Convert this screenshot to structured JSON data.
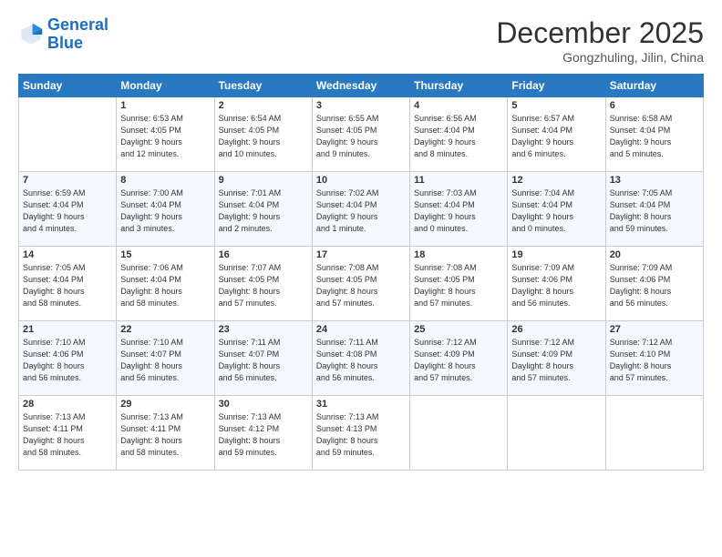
{
  "header": {
    "logo_line1": "General",
    "logo_line2": "Blue",
    "month": "December 2025",
    "location": "Gongzhuling, Jilin, China"
  },
  "weekdays": [
    "Sunday",
    "Monday",
    "Tuesday",
    "Wednesday",
    "Thursday",
    "Friday",
    "Saturday"
  ],
  "weeks": [
    [
      {
        "day": "",
        "info": ""
      },
      {
        "day": "1",
        "info": "Sunrise: 6:53 AM\nSunset: 4:05 PM\nDaylight: 9 hours\nand 12 minutes."
      },
      {
        "day": "2",
        "info": "Sunrise: 6:54 AM\nSunset: 4:05 PM\nDaylight: 9 hours\nand 10 minutes."
      },
      {
        "day": "3",
        "info": "Sunrise: 6:55 AM\nSunset: 4:05 PM\nDaylight: 9 hours\nand 9 minutes."
      },
      {
        "day": "4",
        "info": "Sunrise: 6:56 AM\nSunset: 4:04 PM\nDaylight: 9 hours\nand 8 minutes."
      },
      {
        "day": "5",
        "info": "Sunrise: 6:57 AM\nSunset: 4:04 PM\nDaylight: 9 hours\nand 6 minutes."
      },
      {
        "day": "6",
        "info": "Sunrise: 6:58 AM\nSunset: 4:04 PM\nDaylight: 9 hours\nand 5 minutes."
      }
    ],
    [
      {
        "day": "7",
        "info": "Sunrise: 6:59 AM\nSunset: 4:04 PM\nDaylight: 9 hours\nand 4 minutes."
      },
      {
        "day": "8",
        "info": "Sunrise: 7:00 AM\nSunset: 4:04 PM\nDaylight: 9 hours\nand 3 minutes."
      },
      {
        "day": "9",
        "info": "Sunrise: 7:01 AM\nSunset: 4:04 PM\nDaylight: 9 hours\nand 2 minutes."
      },
      {
        "day": "10",
        "info": "Sunrise: 7:02 AM\nSunset: 4:04 PM\nDaylight: 9 hours\nand 1 minute."
      },
      {
        "day": "11",
        "info": "Sunrise: 7:03 AM\nSunset: 4:04 PM\nDaylight: 9 hours\nand 0 minutes."
      },
      {
        "day": "12",
        "info": "Sunrise: 7:04 AM\nSunset: 4:04 PM\nDaylight: 9 hours\nand 0 minutes."
      },
      {
        "day": "13",
        "info": "Sunrise: 7:05 AM\nSunset: 4:04 PM\nDaylight: 8 hours\nand 59 minutes."
      }
    ],
    [
      {
        "day": "14",
        "info": "Sunrise: 7:05 AM\nSunset: 4:04 PM\nDaylight: 8 hours\nand 58 minutes."
      },
      {
        "day": "15",
        "info": "Sunrise: 7:06 AM\nSunset: 4:04 PM\nDaylight: 8 hours\nand 58 minutes."
      },
      {
        "day": "16",
        "info": "Sunrise: 7:07 AM\nSunset: 4:05 PM\nDaylight: 8 hours\nand 57 minutes."
      },
      {
        "day": "17",
        "info": "Sunrise: 7:08 AM\nSunset: 4:05 PM\nDaylight: 8 hours\nand 57 minutes."
      },
      {
        "day": "18",
        "info": "Sunrise: 7:08 AM\nSunset: 4:05 PM\nDaylight: 8 hours\nand 57 minutes."
      },
      {
        "day": "19",
        "info": "Sunrise: 7:09 AM\nSunset: 4:06 PM\nDaylight: 8 hours\nand 56 minutes."
      },
      {
        "day": "20",
        "info": "Sunrise: 7:09 AM\nSunset: 4:06 PM\nDaylight: 8 hours\nand 56 minutes."
      }
    ],
    [
      {
        "day": "21",
        "info": "Sunrise: 7:10 AM\nSunset: 4:06 PM\nDaylight: 8 hours\nand 56 minutes."
      },
      {
        "day": "22",
        "info": "Sunrise: 7:10 AM\nSunset: 4:07 PM\nDaylight: 8 hours\nand 56 minutes."
      },
      {
        "day": "23",
        "info": "Sunrise: 7:11 AM\nSunset: 4:07 PM\nDaylight: 8 hours\nand 56 minutes."
      },
      {
        "day": "24",
        "info": "Sunrise: 7:11 AM\nSunset: 4:08 PM\nDaylight: 8 hours\nand 56 minutes."
      },
      {
        "day": "25",
        "info": "Sunrise: 7:12 AM\nSunset: 4:09 PM\nDaylight: 8 hours\nand 57 minutes."
      },
      {
        "day": "26",
        "info": "Sunrise: 7:12 AM\nSunset: 4:09 PM\nDaylight: 8 hours\nand 57 minutes."
      },
      {
        "day": "27",
        "info": "Sunrise: 7:12 AM\nSunset: 4:10 PM\nDaylight: 8 hours\nand 57 minutes."
      }
    ],
    [
      {
        "day": "28",
        "info": "Sunrise: 7:13 AM\nSunset: 4:11 PM\nDaylight: 8 hours\nand 58 minutes."
      },
      {
        "day": "29",
        "info": "Sunrise: 7:13 AM\nSunset: 4:11 PM\nDaylight: 8 hours\nand 58 minutes."
      },
      {
        "day": "30",
        "info": "Sunrise: 7:13 AM\nSunset: 4:12 PM\nDaylight: 8 hours\nand 59 minutes."
      },
      {
        "day": "31",
        "info": "Sunrise: 7:13 AM\nSunset: 4:13 PM\nDaylight: 8 hours\nand 59 minutes."
      },
      {
        "day": "",
        "info": ""
      },
      {
        "day": "",
        "info": ""
      },
      {
        "day": "",
        "info": ""
      }
    ]
  ]
}
